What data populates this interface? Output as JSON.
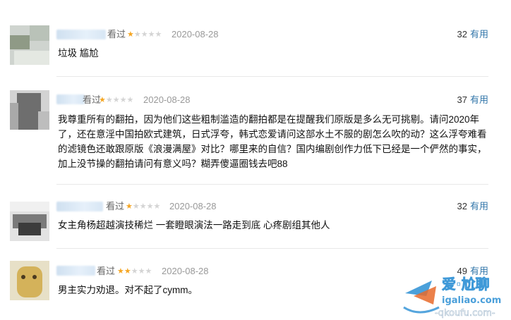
{
  "reviews": [
    {
      "verb": "看过",
      "stars_filled": 1,
      "stars_empty": 4,
      "date": "2020-08-28",
      "votes_count": "32",
      "votes_label": "有用",
      "content": "垃圾 尴尬"
    },
    {
      "verb": "看过",
      "stars_filled": 1,
      "stars_empty": 4,
      "date": "2020-08-28",
      "votes_count": "37",
      "votes_label": "有用",
      "content": "我尊重所有的翻拍，因为他们这些粗制滥造的翻拍都是在提醒我们原版是多么无可挑剔。请问2020年了，还在意淫中国拍欧式建筑，日式浮夸，韩式恋爱请问这部水土不服的剧怎么吹的动？这么浮夸难看的滤镜色还敢跟原版《浪漫满屋》对比？哪里来的自信？国内编剧创作力低下已经是一个俨然的事实，加上没节操的翻拍请问有意义吗？糊弄傻逼圈钱去吧88"
    },
    {
      "verb": "看过",
      "stars_filled": 1,
      "stars_empty": 4,
      "date": "2020-08-28",
      "votes_count": "32",
      "votes_label": "有用",
      "content": "女主角杨超越演技稀烂 一套瞪眼演法一路走到底 心疼剧组其他人"
    },
    {
      "verb": "看过",
      "stars_filled": 2,
      "stars_empty": 3,
      "date": "2020-08-28",
      "votes_count": "49",
      "votes_label": "有用",
      "content": "男主实力劝退。对不起了cymm。"
    }
  ],
  "icons": {
    "star_filled": "★",
    "star_empty": "★"
  },
  "watermark": {
    "text_main": "爱·尬聊",
    "text_site": "igaliao.com",
    "text_url": "-qkoufu.com-"
  },
  "colors": {
    "link": "#3377aa",
    "star_on": "#f5a623",
    "star_off": "#d4d4d4",
    "date": "#999999"
  }
}
